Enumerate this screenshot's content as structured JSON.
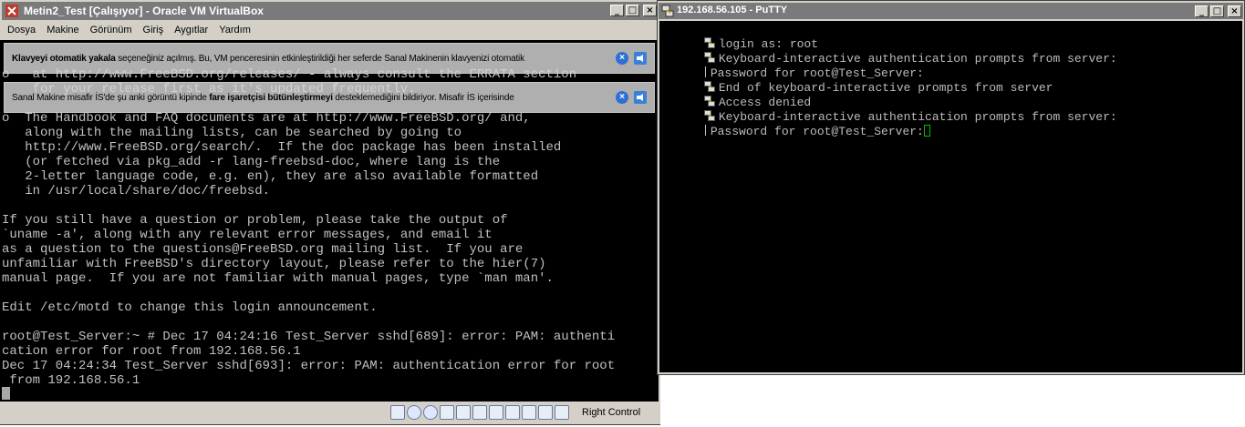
{
  "vbox": {
    "title": "Metin2_Test [Çalışıyor] - Oracle VM VirtualBox",
    "menu": [
      "Dosya",
      "Makine",
      "Görünüm",
      "Giriş",
      "Aygıtlar",
      "Yardım"
    ],
    "console_text": "o   at http://www.FreeBSD.org/releases/ - always consult the ERRATA section\n    for your release first as it's updated frequently.\n\no  The Handbook and FAQ documents are at http://www.FreeBSD.org/ and,\n   along with the mailing lists, can be searched by going to\n   http://www.FreeBSD.org/search/.  If the doc package has been installed\n   (or fetched via pkg_add -r lang-freebsd-doc, where lang is the\n   2-letter language code, e.g. en), they are also available formatted\n   in /usr/local/share/doc/freebsd.\n\nIf you still have a question or problem, please take the output of\n`uname -a', along with any relevant error messages, and email it\nas a question to the questions@FreeBSD.org mailing list.  If you are\nunfamiliar with FreeBSD's directory layout, please refer to the hier(7)\nmanual page.  If you are not familiar with manual pages, type `man man'.\n\nEdit /etc/motd to change this login announcement.\n\nroot@Test_Server:~ # Dec 17 04:24:16 Test_Server sshd[689]: error: PAM: authenti\ncation error for root from 192.168.56.1\nDec 17 04:24:34 Test_Server sshd[693]: error: PAM: authentication error for root\n from 192.168.56.1",
    "notice1": {
      "bold": "Klavyeyi otomatik yakala",
      "rest": " seçeneğiniz açılmış. Bu, VM penceresinin etkinleştirildiği her seferde Sanal Makinenin klavyenizi otomatik"
    },
    "notice2": {
      "pre": "Sanal Makine misafir İS'de şu anki görüntü kipinde ",
      "bold": "fare işaretçisi bütünleştirmeyi",
      "post": " desteklemediğini bildiriyor. Misafir İS içerisinde"
    },
    "host_key": "Right Control"
  },
  "putty": {
    "title": "192.168.56.105 - PuTTY",
    "lines": [
      {
        "icon": true,
        "text": "login as: root"
      },
      {
        "icon": true,
        "text": "Keyboard-interactive authentication prompts from server:"
      },
      {
        "bar": true,
        "text": "Password for root@Test_Server:"
      },
      {
        "icon": true,
        "text": "End of keyboard-interactive prompts from server"
      },
      {
        "icon": true,
        "text": "Access denied"
      },
      {
        "icon": true,
        "text": "Keyboard-interactive authentication prompts from server:"
      },
      {
        "bar": true,
        "text": "Password for root@Test_Server:"
      }
    ]
  },
  "colors": {
    "terminal_bg": "#000000",
    "terminal_fg": "#bbbbbb",
    "cursor": "#00c000",
    "titlebar_inactive": "#7a7a7a",
    "notice_button": "#2e6fd6"
  }
}
